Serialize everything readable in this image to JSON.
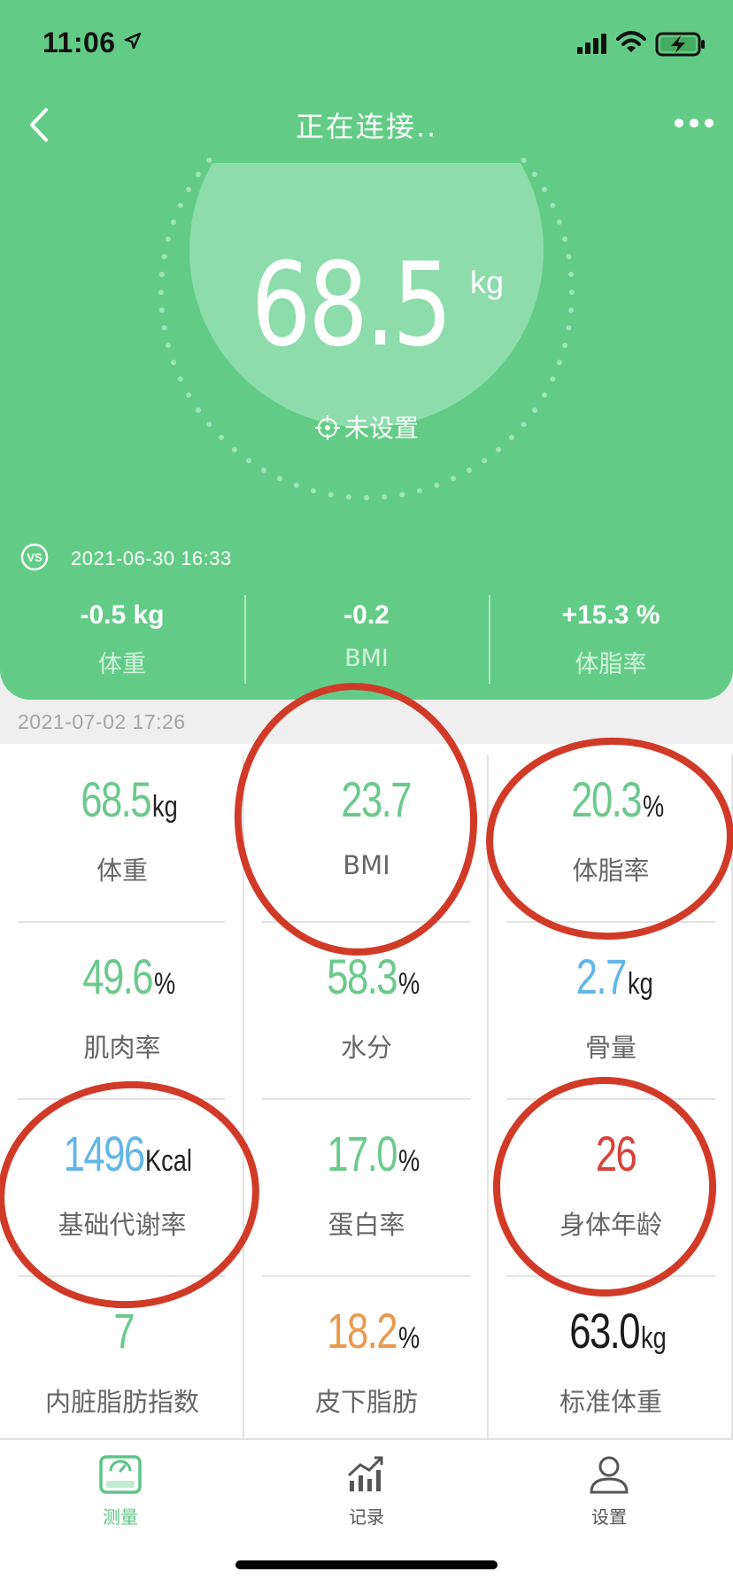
{
  "status_bar": {
    "time": "11:06"
  },
  "header": {
    "title": "正在连接.."
  },
  "current": {
    "weight": "68.5",
    "unit": "kg",
    "target_label": "未设置"
  },
  "compare": {
    "date": "2021-06-30 16:33",
    "items": [
      {
        "value": "-0.5 kg",
        "label": "体重"
      },
      {
        "value": "-0.2",
        "label": "BMI"
      },
      {
        "value": "+15.3 %",
        "label": "体脂率"
      }
    ]
  },
  "measure_date": "2021-07-02 17:26",
  "metrics": [
    {
      "value": "68.5",
      "unit": "kg",
      "label": "体重",
      "color": "#6cc98c"
    },
    {
      "value": "23.7",
      "unit": "",
      "label": "BMI",
      "color": "#6cc98c"
    },
    {
      "value": "20.3",
      "unit": "%",
      "label": "体脂率",
      "color": "#6cc98c"
    },
    {
      "value": "49.6",
      "unit": "%",
      "label": "肌肉率",
      "color": "#6cc98c"
    },
    {
      "value": "58.3",
      "unit": "%",
      "label": "水分",
      "color": "#6cc98c"
    },
    {
      "value": "2.7",
      "unit": "kg",
      "label": "骨量",
      "color": "#62b6e8"
    },
    {
      "value": "1496",
      "unit": "Kcal",
      "label": "基础代谢率",
      "color": "#62b6e8"
    },
    {
      "value": "17.0",
      "unit": "%",
      "label": "蛋白率",
      "color": "#6cc98c"
    },
    {
      "value": "26",
      "unit": "",
      "label": "身体年龄",
      "color": "#d8423a"
    },
    {
      "value": "7",
      "unit": "",
      "label": "内脏脂肪指数",
      "color": "#6cc98c"
    },
    {
      "value": "18.2",
      "unit": "%",
      "label": "皮下脂肪",
      "color": "#e99a4c"
    },
    {
      "value": "63.0",
      "unit": "kg",
      "label": "标准体重",
      "color": "#1a1a1a"
    }
  ],
  "tabs": [
    {
      "label": "测量",
      "icon": "scale-icon",
      "active": true
    },
    {
      "label": "记录",
      "icon": "chart-icon",
      "active": false
    },
    {
      "label": "设置",
      "icon": "user-icon",
      "active": false
    }
  ],
  "colors": {
    "brand": "#62cc87",
    "annotation": "#d23a28"
  }
}
